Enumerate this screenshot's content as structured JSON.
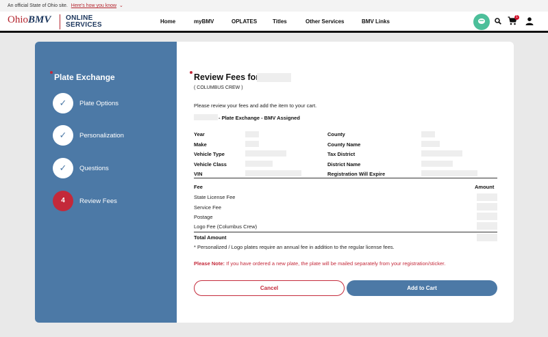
{
  "topbar": {
    "official_text": "An official State of Ohio site.",
    "link_text": "Here's how you know"
  },
  "header": {
    "logo_ohio": "Ohio",
    "logo_bmv": "BMV",
    "logo_sub_line1": "ONLINE",
    "logo_sub_line2": "SERVICES",
    "nav": [
      "Home",
      "myBMV",
      "OPLATES",
      "Titles",
      "Other Services",
      "BMV Links"
    ],
    "cart_count": "1",
    "chat_dots": "•••"
  },
  "sidebar": {
    "title": "Plate Exchange",
    "check_glyph": "✓",
    "steps": [
      {
        "label": "Plate Options",
        "state": "done"
      },
      {
        "label": "Personalization",
        "state": "done"
      },
      {
        "label": "Questions",
        "state": "done"
      },
      {
        "label": "Review Fees",
        "state": "active",
        "number": "4"
      }
    ]
  },
  "main": {
    "title": "Review Fees for",
    "subtitle": "( COLUMBUS CREW )",
    "intro": "Please review your fees and add the item to your cart.",
    "plate_type": "- Plate Exchange - BMV Assigned",
    "vehicle_left": [
      "Year",
      "Make",
      "Vehicle Type",
      "Vehicle Class",
      "VIN"
    ],
    "vehicle_right": [
      "County",
      "County Name",
      "Tax District",
      "District Name",
      "Registration Will Expire"
    ],
    "fee_header": "Fee",
    "amount_header": "Amount",
    "fees": [
      "State License Fee",
      "Service Fee",
      "Postage",
      "Logo Fee (Columbus Crew)"
    ],
    "total_label": "Total Amount",
    "footnote": "* Personalized / Logo plates require an annual fee in addition to the regular license fees.",
    "note_label": "Please Note:",
    "note_text": " If you have ordered a new plate, the plate will be mailed separately from your registration/sticker.",
    "cancel_label": "Cancel",
    "add_label": "Add to Cart"
  },
  "colors": {
    "brand_red": "#c4293a",
    "brand_blue": "#4c79a6",
    "chat_green": "#4cbf9a"
  }
}
